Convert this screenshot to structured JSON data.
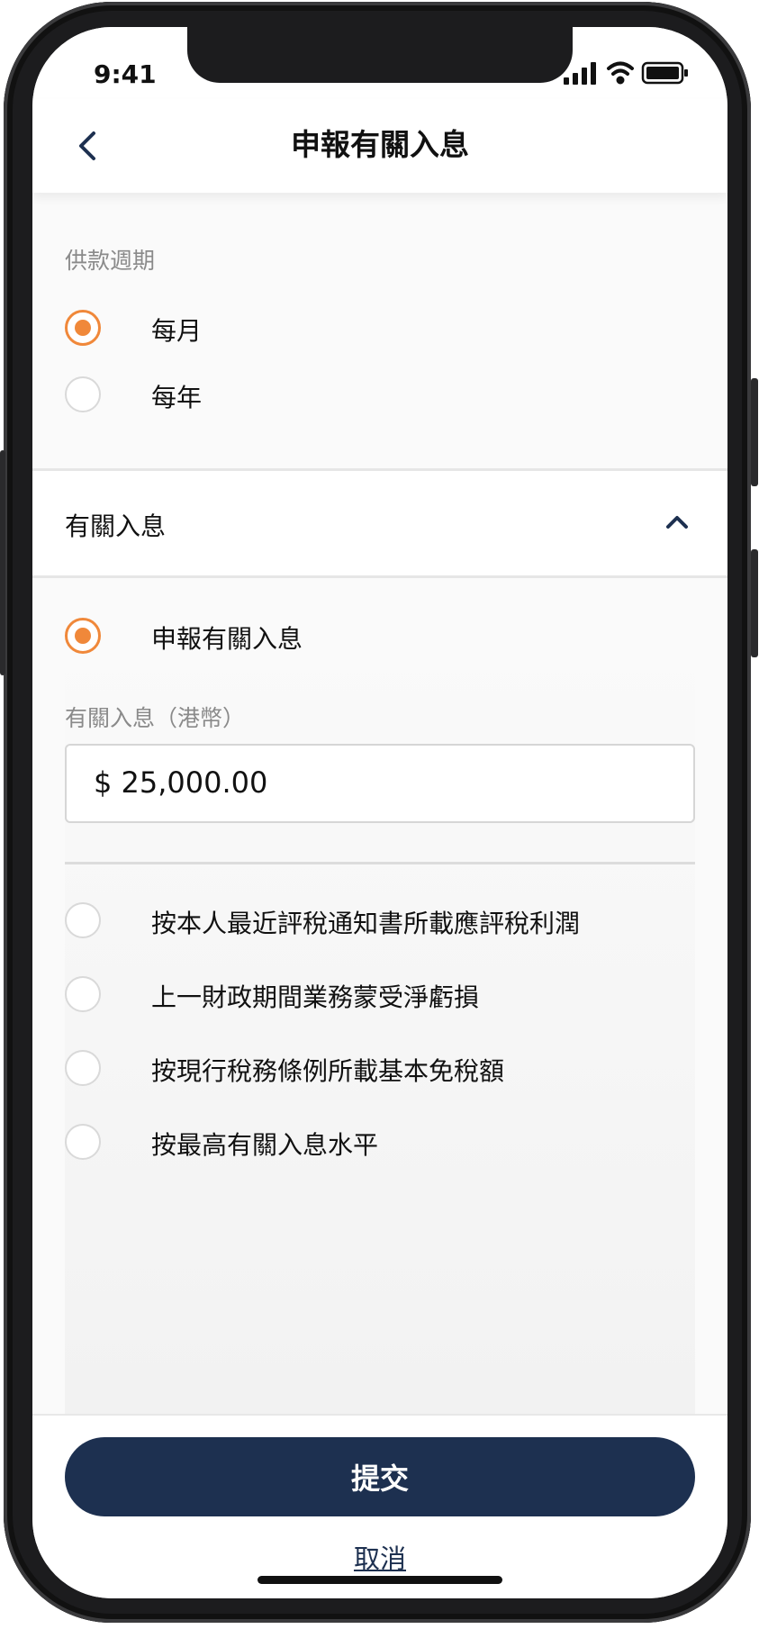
{
  "status": {
    "time": "9:41"
  },
  "header": {
    "title": "申報有關入息"
  },
  "contribution_period": {
    "label": "供款週期",
    "options": [
      {
        "label": "每月",
        "selected": true
      },
      {
        "label": "每年",
        "selected": false
      }
    ]
  },
  "relevant_income": {
    "section_title": "有關入息",
    "declare_option": {
      "label": "申報有關入息",
      "selected": true
    },
    "amount_label": "有關入息（港幣）",
    "amount_value": "$ 25,000.00",
    "other_options": [
      {
        "label": "按本人最近評稅通知書所載應評稅利潤",
        "selected": false
      },
      {
        "label": "上一財政期間業務蒙受淨虧損",
        "selected": false
      },
      {
        "label": "按現行稅務條例所載基本免稅額",
        "selected": false
      },
      {
        "label": "按最高有關入息水平",
        "selected": false
      }
    ]
  },
  "footer": {
    "submit_label": "提交",
    "cancel_label": "取消"
  },
  "colors": {
    "accent": "#f0883a",
    "primary": "#1d3050"
  }
}
